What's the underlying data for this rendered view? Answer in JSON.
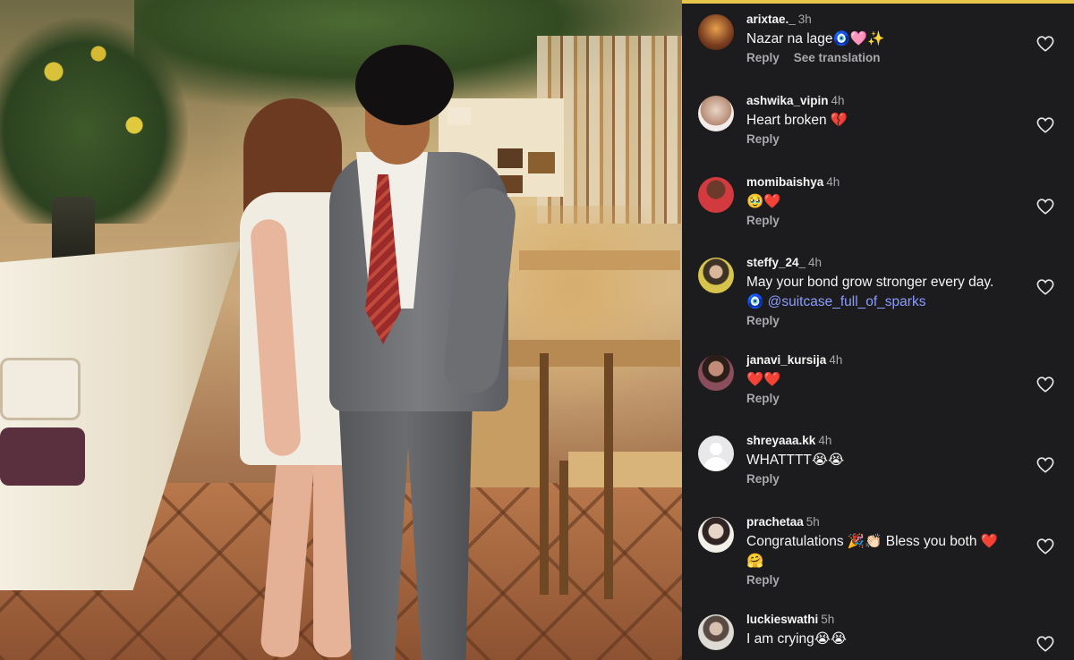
{
  "photo": {
    "description_icon": "couple-photo"
  },
  "comments": [
    {
      "username": "arixtae._",
      "time": "3h",
      "text": "Nazar na lage🧿🩷✨",
      "actions": [
        "Reply",
        "See translation"
      ],
      "avatar_class": "a1"
    },
    {
      "username": "ashwika_vipin",
      "time": "4h",
      "text": "Heart broken 💔",
      "actions": [
        "Reply"
      ],
      "avatar_class": "a2"
    },
    {
      "username": "momibaishya",
      "time": "4h",
      "text": "🥹❤️",
      "actions": [
        "Reply"
      ],
      "avatar_class": "a3"
    },
    {
      "username": "steffy_24_",
      "time": "4h",
      "text": "May your bond grow stronger every day.",
      "text2": "🧿 ",
      "mention": "@suitcase_full_of_sparks",
      "actions": [
        "Reply"
      ],
      "avatar_class": "a4"
    },
    {
      "username": "janavi_kursija",
      "time": "4h",
      "text": "❤️❤️",
      "actions": [
        "Reply"
      ],
      "avatar_class": "a5"
    },
    {
      "username": "shreyaaa.kk",
      "time": "4h",
      "text": "WHATTTT😭😭",
      "actions": [
        "Reply"
      ],
      "avatar_class": "a6"
    },
    {
      "username": "prachetaa",
      "time": "5h",
      "text": "Congratulations 🎉👏🏻 Bless you both ❤️",
      "text2": "🤗",
      "actions": [
        "Reply"
      ],
      "avatar_class": "a7"
    },
    {
      "username": "luckieswathi",
      "time": "5h",
      "text": "I am crying😭😭",
      "actions": [],
      "avatar_class": "a8"
    }
  ],
  "icons": {
    "like": "heart-outline-icon"
  },
  "colors": {
    "panel_bg": "#1c1c1e",
    "text": "#f5f5f5",
    "muted": "#a8a8ad",
    "mention": "#8b9cff",
    "accent_bar": "#e7c44a"
  }
}
